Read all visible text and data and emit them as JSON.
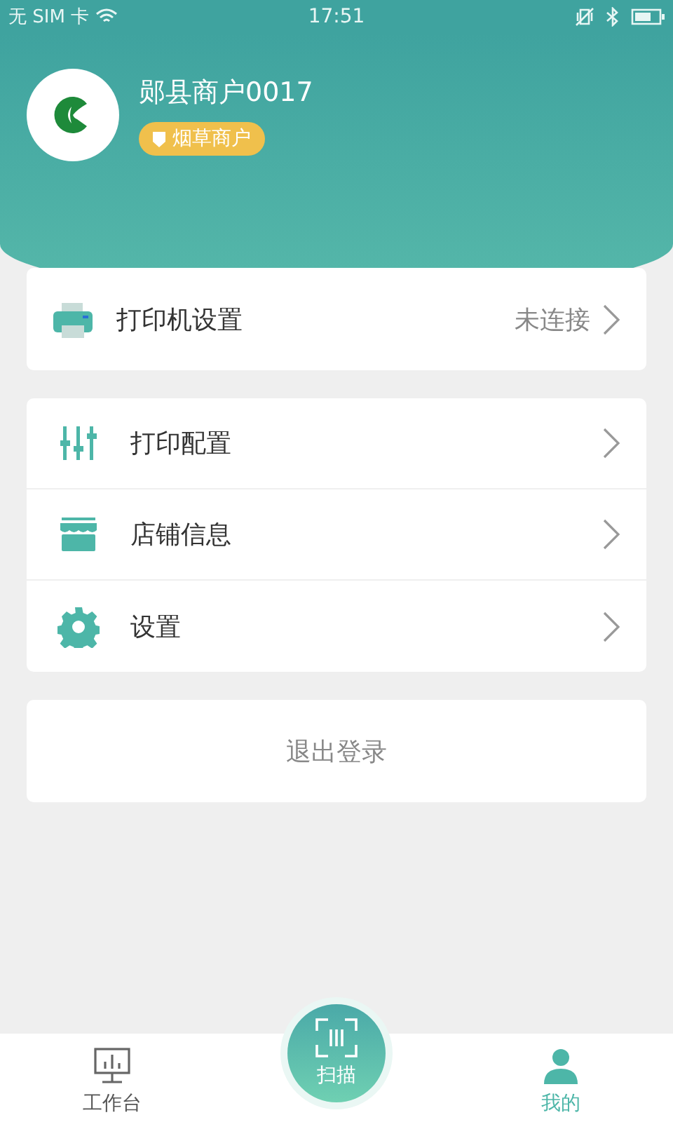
{
  "status_bar": {
    "carrier": "无 SIM 卡",
    "time": "17:51"
  },
  "profile": {
    "name": "郧县商户0017",
    "badge": "烟草商户"
  },
  "printer": {
    "label": "打印机设置",
    "status": "未连接"
  },
  "menu": [
    {
      "kind": "sliders",
      "label": "打印配置"
    },
    {
      "kind": "store",
      "label": "店铺信息"
    },
    {
      "kind": "gear",
      "label": "设置"
    }
  ],
  "logout": "退出登录",
  "tabs": [
    {
      "kind": "monitor",
      "label": "工作台",
      "selected": false
    },
    {
      "kind": "scan",
      "label": "扫描",
      "selected": false
    },
    {
      "kind": "person",
      "label": "我的",
      "selected": true
    }
  ]
}
